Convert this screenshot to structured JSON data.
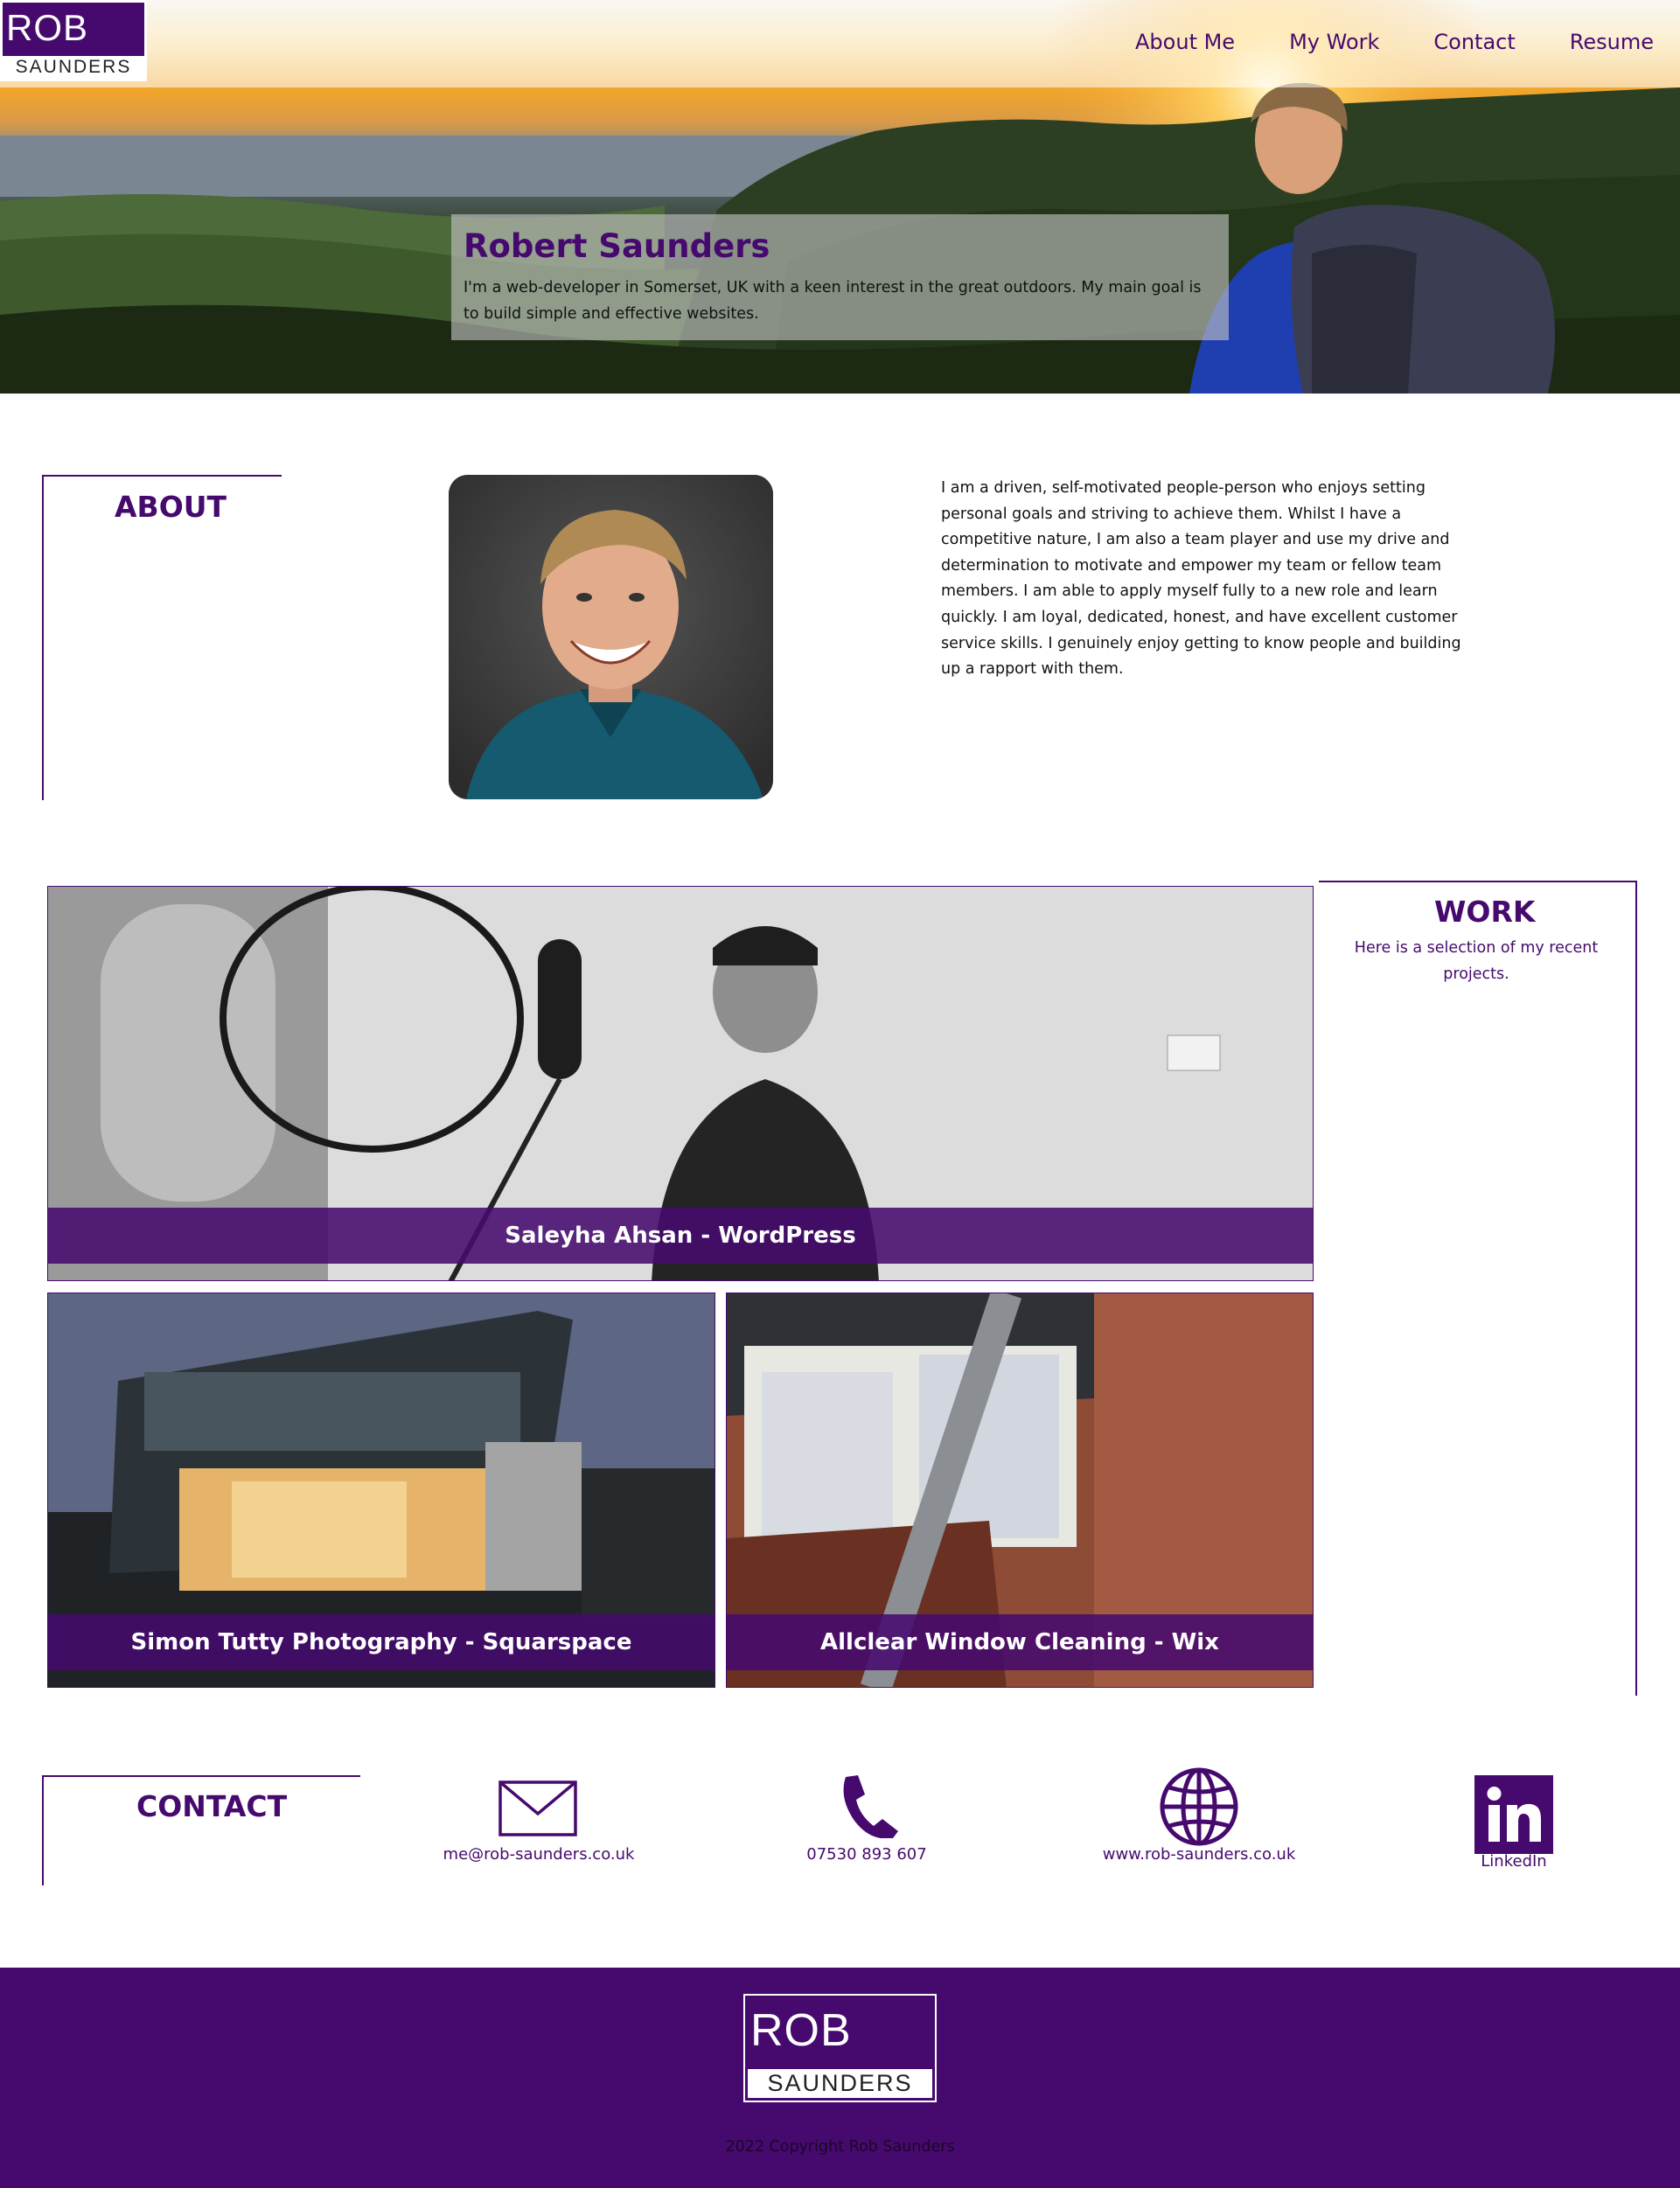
{
  "header": {
    "logo": {
      "line1": "ROB",
      "line2": "SAUNDERS"
    },
    "nav": [
      {
        "label": "About Me"
      },
      {
        "label": "My Work"
      },
      {
        "label": "Contact"
      },
      {
        "label": "Resume"
      }
    ]
  },
  "hero": {
    "name": "Robert Saunders",
    "intro": "I'm a web-developer in Somerset, UK with a keen interest in the great outdoors. My main goal is to build simple and effective websites."
  },
  "about": {
    "title": "ABOUT",
    "text": "I am a driven, self-motivated people-person who enjoys setting personal goals and striving to achieve them. Whilst I have a competitive nature, I am also a team player and use my drive and determination to motivate and empower my team or fellow team members. I am able to apply myself fully to a new role and learn quickly. I am loyal, dedicated, honest, and have excellent customer service skills. I genuinely enjoy getting to know people and building up a rapport with them."
  },
  "work": {
    "title": "WORK",
    "subtitle": "Here is a selection of my recent projects.",
    "projects": [
      {
        "label": "Saleyha Ahsan - WordPress"
      },
      {
        "label": "Simon Tutty Photography - Squarspace"
      },
      {
        "label": "Allclear Window Cleaning - Wix"
      }
    ]
  },
  "contact": {
    "title": "CONTACT",
    "items": [
      {
        "icon": "envelope-icon",
        "label": "me@rob-saunders.co.uk"
      },
      {
        "icon": "phone-icon",
        "label": "07530 893 607"
      },
      {
        "icon": "globe-icon",
        "label": "www.rob-saunders.co.uk"
      },
      {
        "icon": "linkedin-icon",
        "label": "LinkedIn"
      }
    ]
  },
  "footer": {
    "logo": {
      "line1": "ROB",
      "line2": "SAUNDERS"
    },
    "copyright": "2022 Copyright Rob Saunders"
  },
  "colors": {
    "brand": "#460a6e",
    "white": "#ffffff"
  }
}
